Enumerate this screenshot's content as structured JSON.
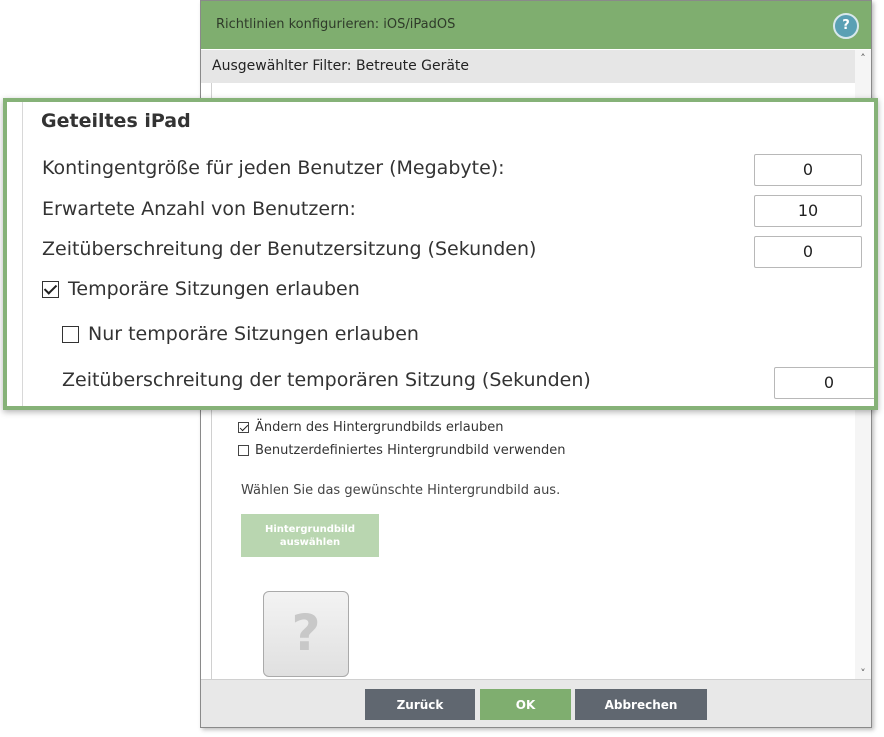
{
  "dialog": {
    "title": "Richtlinien konfigurieren: iOS/iPadOS",
    "help_label": "?",
    "filter_label": "Ausgewählter Filter: Betreute Geräte",
    "scroll_up": "˄",
    "scroll_down": "˅"
  },
  "zoom_panel": {
    "heading": "Geteiltes iPad",
    "quota_label": "Kontingentgröße für jeden Benutzer (Megabyte):",
    "quota_value": "0",
    "expected_users_label": "Erwartete Anzahl von Benutzern:",
    "expected_users_value": "10",
    "session_timeout_label": "Zeitüberschreitung der Benutzersitzung (Sekunden)",
    "session_timeout_value": "0",
    "allow_temp_sessions_label": "Temporäre Sitzungen erlauben",
    "allow_temp_sessions_checked": true,
    "only_temp_sessions_label": "Nur temporäre Sitzungen erlauben",
    "only_temp_sessions_checked": false,
    "temp_session_timeout_label": "Zeitüberschreitung der temporären Sitzung (Sekunden)",
    "temp_session_timeout_value": "0"
  },
  "wallpaper": {
    "allow_change_label": "Ändern des Hintergrundbilds erlauben",
    "allow_change_checked": true,
    "custom_label": "Benutzerdefiniertes Hintergrundbild verwenden",
    "custom_checked": false,
    "hint": "Wählen Sie das gewünschte Hintergrundbild aus.",
    "choose_button_line1": "Hintergrundbild",
    "choose_button_line2": "auswählen",
    "placeholder_glyph": "?"
  },
  "footer": {
    "back_label": "Zurück",
    "ok_label": "OK",
    "cancel_label": "Abbrechen"
  },
  "colors": {
    "accent_green": "#7fae6f",
    "zoom_border": "#86b278",
    "button_gray": "#606770",
    "disabled_green": "#b9d6b0",
    "help_blue": "#5aa0b4"
  }
}
